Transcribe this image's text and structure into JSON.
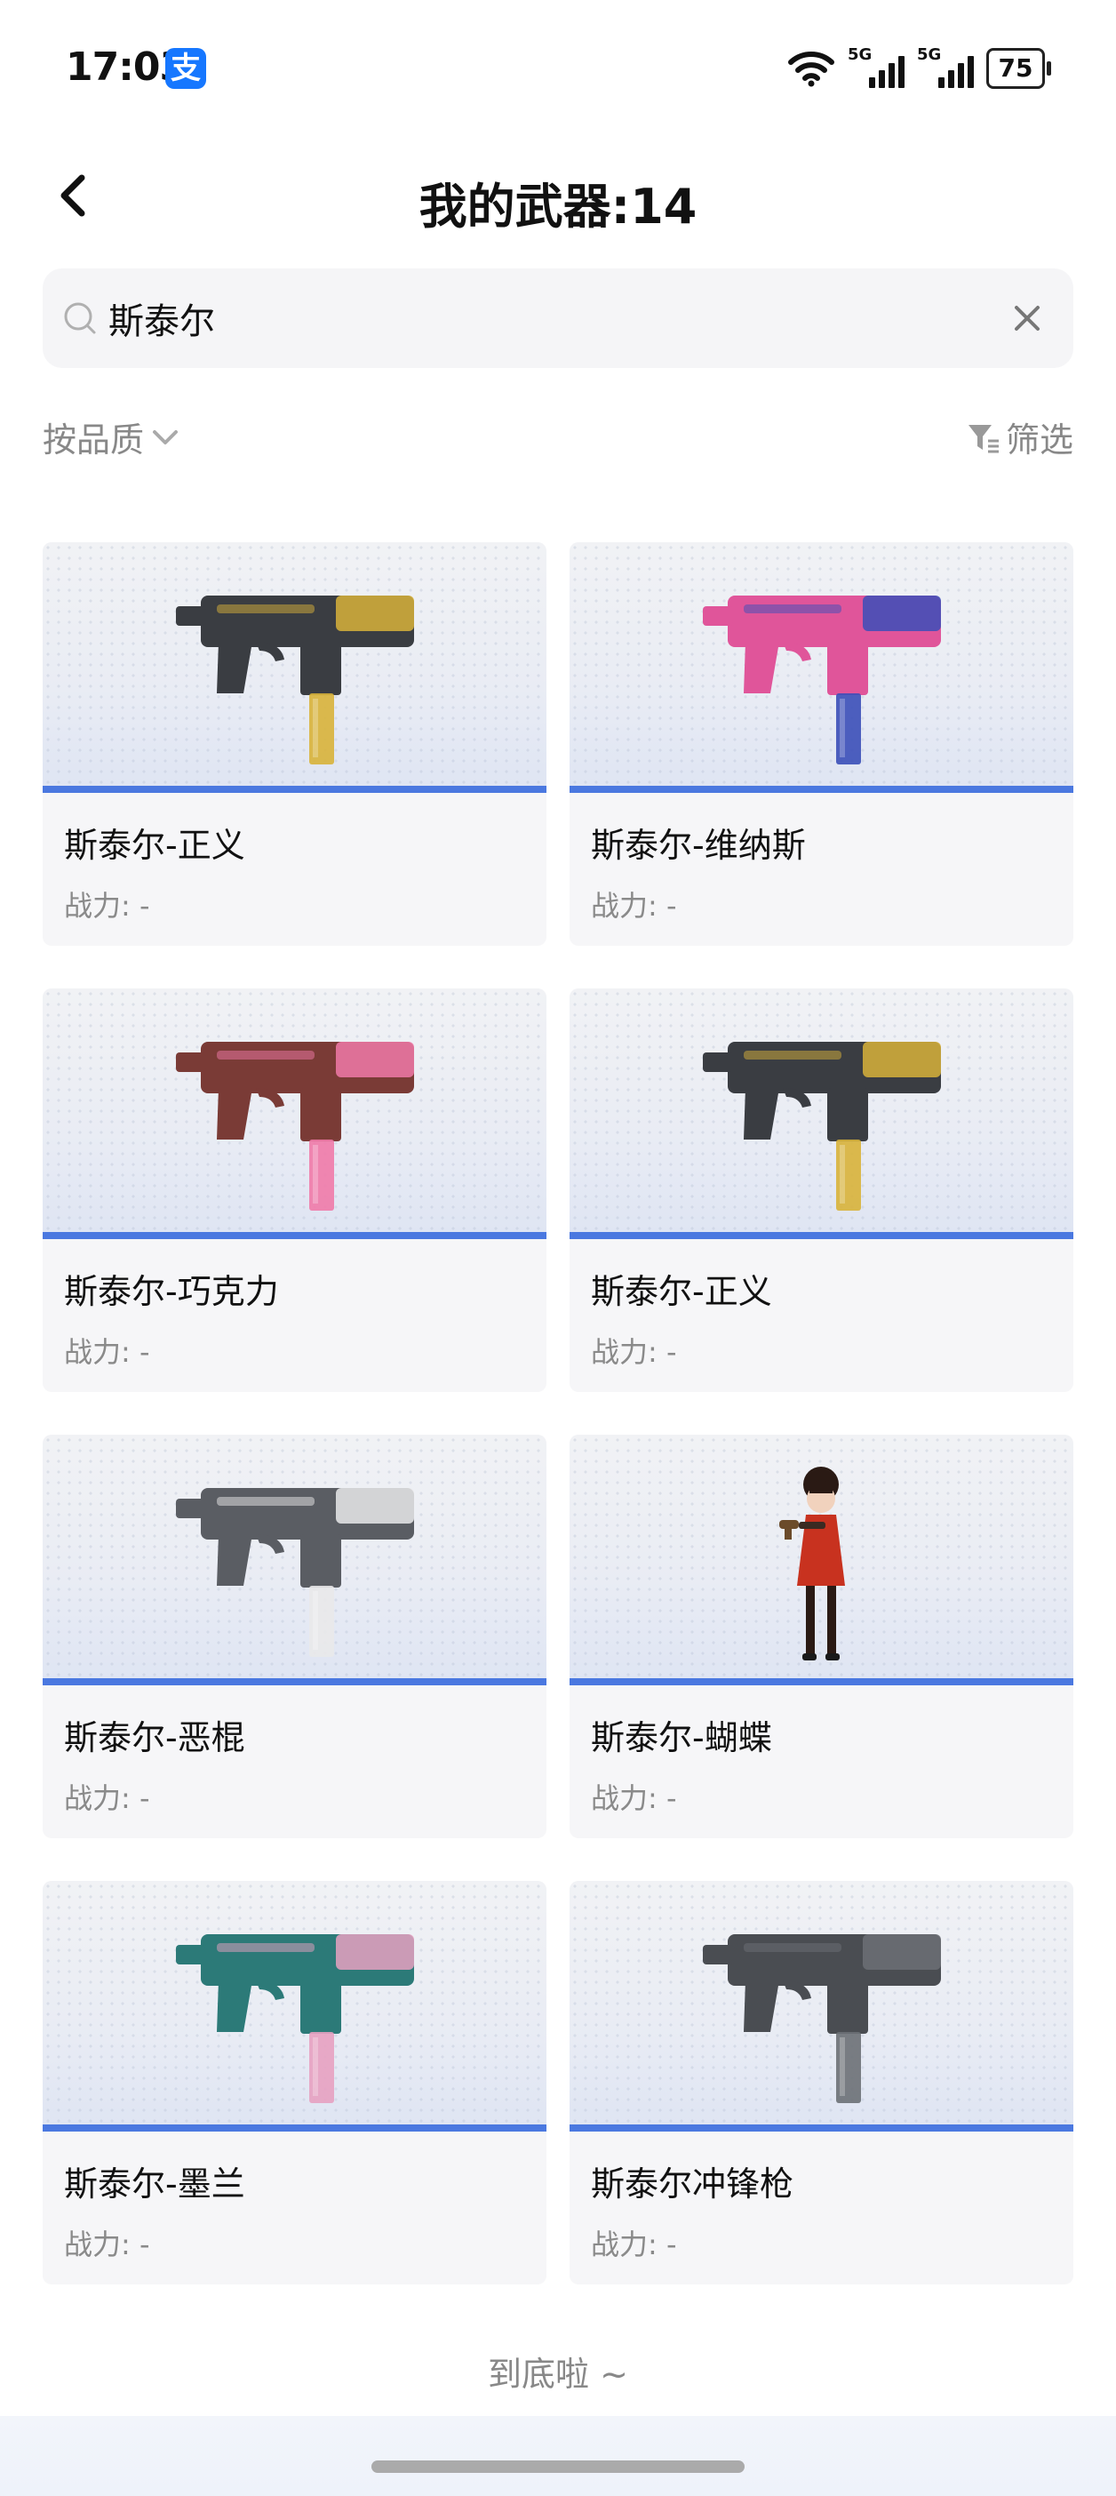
{
  "status_bar": {
    "time": "17:03",
    "app_badge": "支",
    "network_1": "5G",
    "network_2": "5G",
    "battery": "75"
  },
  "header": {
    "title": "我的武器:14"
  },
  "search": {
    "value": "斯泰尔",
    "placeholder": ""
  },
  "filters": {
    "sort_label": "按品质",
    "filter_label": "筛选"
  },
  "weapons": [
    {
      "name": "斯泰尔-正义",
      "power": "战力: -",
      "skin": "justice",
      "colors": {
        "body": "#3a3d42",
        "accent": "#d8b23a"
      }
    },
    {
      "name": "斯泰尔-维纳斯",
      "power": "战力: -",
      "skin": "venus",
      "colors": {
        "body": "#e0559a",
        "accent": "#3b4fb8"
      }
    },
    {
      "name": "斯泰尔-巧克力",
      "power": "战力: -",
      "skin": "chocolate",
      "colors": {
        "body": "#7a3b36",
        "accent": "#f07aa8"
      }
    },
    {
      "name": "斯泰尔-正义",
      "power": "战力: -",
      "skin": "justice",
      "colors": {
        "body": "#3a3d42",
        "accent": "#d8b23a"
      }
    },
    {
      "name": "斯泰尔-恶棍",
      "power": "战力: -",
      "skin": "villain",
      "colors": {
        "body": "#5a5d63",
        "accent": "#e9e9ea"
      }
    },
    {
      "name": "斯泰尔-蝴蝶",
      "power": "战力: -",
      "skin": "butterfly-character",
      "colors": {
        "body": "#c8321f",
        "accent": "#2a1a14"
      }
    },
    {
      "name": "斯泰尔-墨兰",
      "power": "战力: -",
      "skin": "orchid",
      "colors": {
        "body": "#2c7a78",
        "accent": "#e7a1c1"
      }
    },
    {
      "name": "斯泰尔冲锋枪",
      "power": "战力: -",
      "skin": "default",
      "colors": {
        "body": "#4a4d52",
        "accent": "#6c7076"
      }
    }
  ],
  "footer": {
    "end_text": "到底啦 ~"
  }
}
